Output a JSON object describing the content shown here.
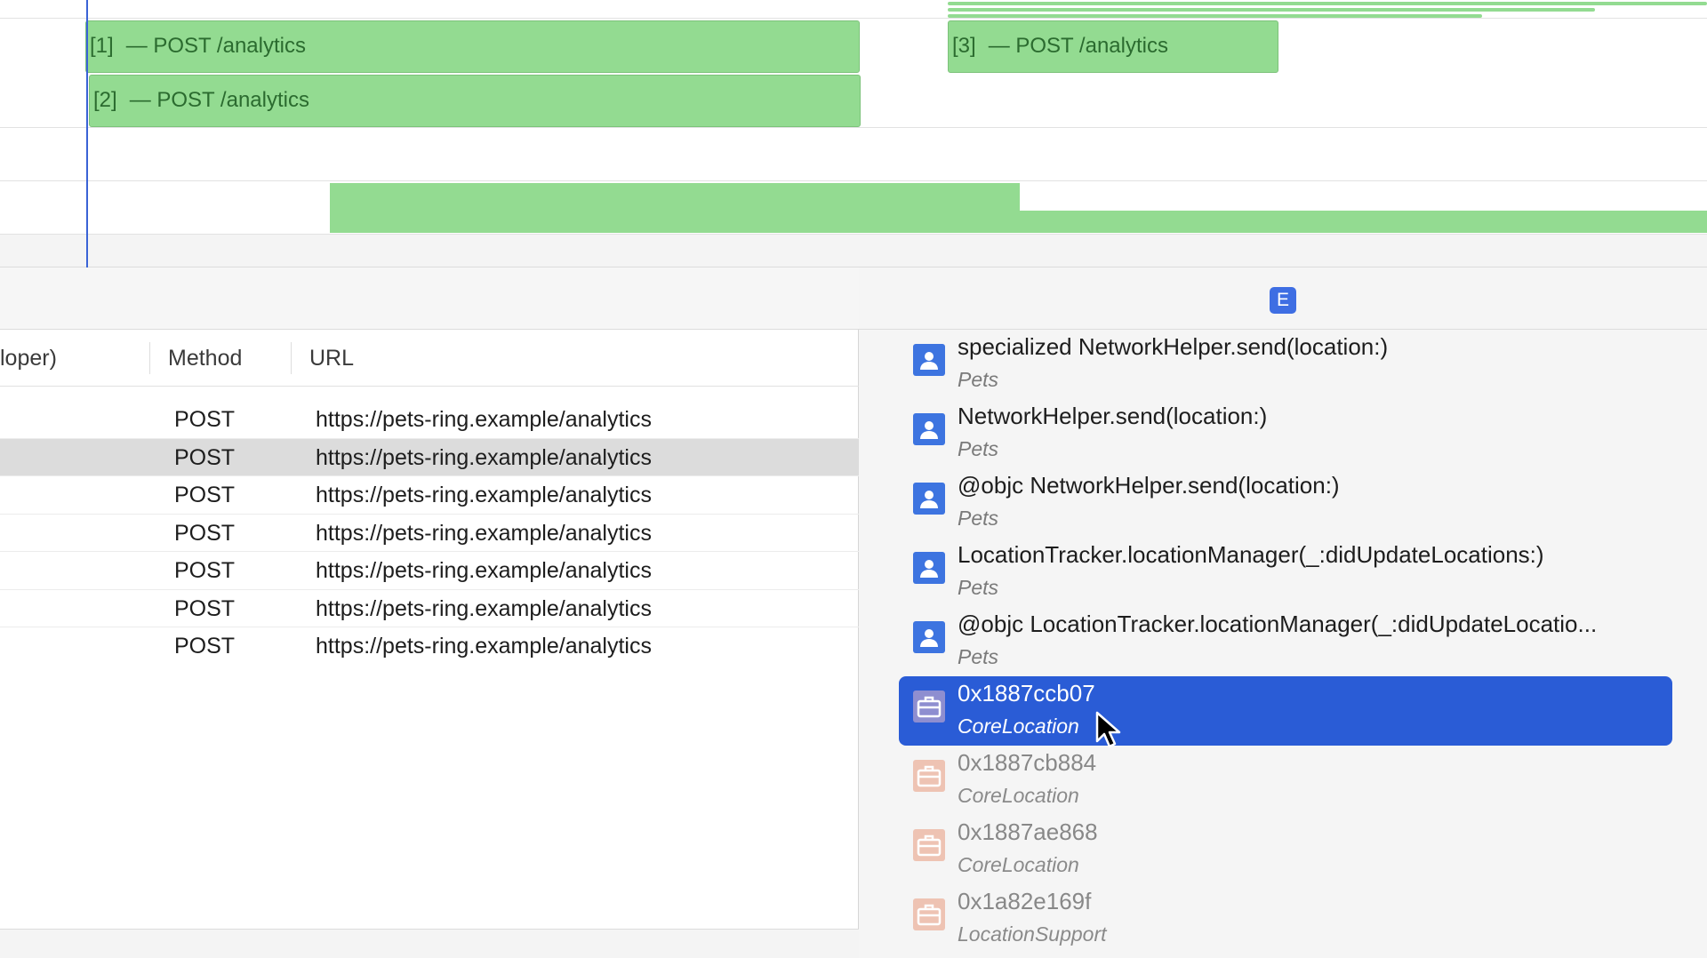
{
  "timeline": {
    "bars": [
      {
        "index": "[1]",
        "label": "— POST /analytics"
      },
      {
        "index": "[2]",
        "label": "— POST /analytics"
      },
      {
        "index": "[3]",
        "label": "— POST /analytics"
      }
    ]
  },
  "table": {
    "columns": [
      "loper)",
      "Method",
      "URL"
    ],
    "rows": [
      {
        "method": "POST",
        "url": "https://pets-ring.example/analytics"
      },
      {
        "method": "POST",
        "url": "https://pets-ring.example/analytics",
        "selected": true
      },
      {
        "method": "POST",
        "url": "https://pets-ring.example/analytics"
      },
      {
        "method": "POST",
        "url": "https://pets-ring.example/analytics"
      },
      {
        "method": "POST",
        "url": "https://pets-ring.example/analytics"
      },
      {
        "method": "POST",
        "url": "https://pets-ring.example/analytics"
      },
      {
        "method": "POST",
        "url": "https://pets-ring.example/analytics"
      }
    ]
  },
  "stack": {
    "badge": "E",
    "frames": [
      {
        "fn": "specialized NetworkHelper.send(location:)",
        "module": "Pets",
        "icon": "user-code-icon"
      },
      {
        "fn": "NetworkHelper.send(location:)",
        "module": "Pets",
        "icon": "user-code-icon"
      },
      {
        "fn": "@objc NetworkHelper.send(location:)",
        "module": "Pets",
        "icon": "user-code-icon"
      },
      {
        "fn": "LocationTracker.locationManager(_:didUpdateLocations:)",
        "module": "Pets",
        "icon": "user-code-icon"
      },
      {
        "fn": "@objc LocationTracker.locationManager(_:didUpdateLocatio...",
        "module": "Pets",
        "icon": "user-code-icon"
      },
      {
        "fn": "0x1887ccb07",
        "module": "CoreLocation",
        "icon": "library-icon",
        "selected": true
      },
      {
        "fn": "0x1887cb884",
        "module": "CoreLocation",
        "icon": "library-icon"
      },
      {
        "fn": "0x1887ae868",
        "module": "CoreLocation",
        "icon": "library-icon"
      },
      {
        "fn": "0x1a82e169f",
        "module": "LocationSupport",
        "icon": "library-icon"
      }
    ]
  },
  "colors": {
    "accent": "#2a5cd6",
    "bar_fill": "#93db91",
    "bar_text": "#2b6b2f",
    "playhead": "#3a63d6"
  }
}
